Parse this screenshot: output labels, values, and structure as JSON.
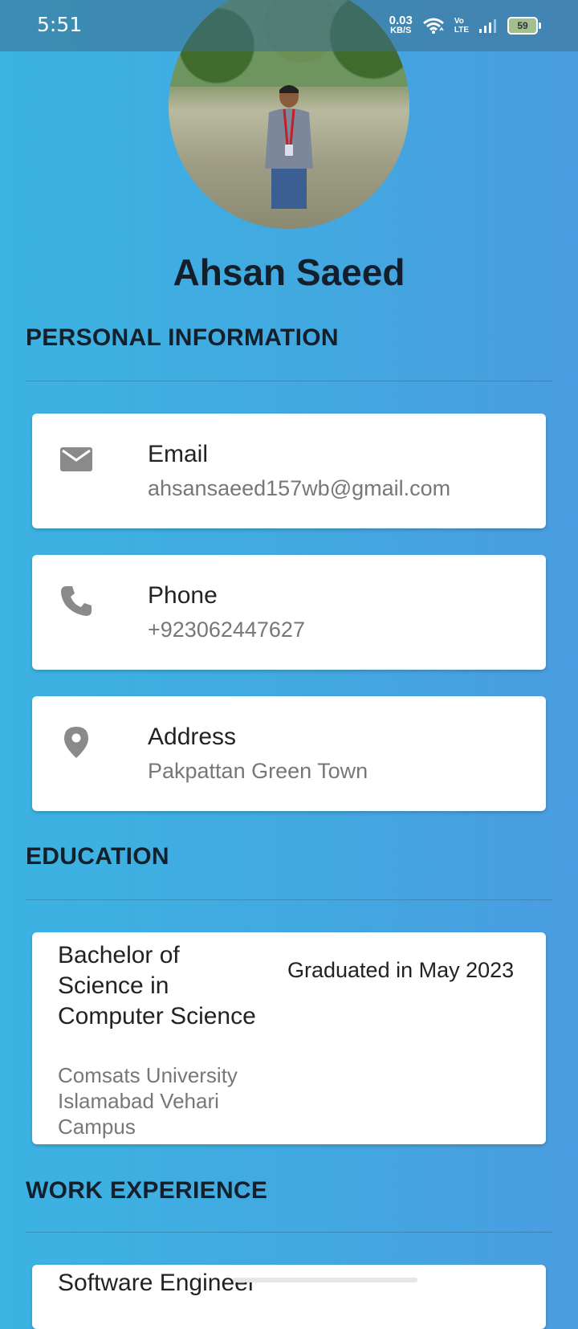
{
  "status_bar": {
    "time": "5:51",
    "net_speed_value": "0.03",
    "net_speed_unit": "KB/S",
    "volte_top": "Vo",
    "volte_bottom": "LTE",
    "battery": "59"
  },
  "profile": {
    "name": "Ahsan Saeed"
  },
  "personal_information": {
    "title": "PERSONAL INFORMATION",
    "items": [
      {
        "icon": "email-icon",
        "label": "Email",
        "value": "ahsansaeed157wb@gmail.com"
      },
      {
        "icon": "phone-icon",
        "label": "Phone",
        "value": "+923062447627"
      },
      {
        "icon": "location-icon",
        "label": "Address",
        "value": "Pakpattan Green Town"
      }
    ]
  },
  "education": {
    "title": "EDUCATION",
    "items": [
      {
        "degree": "Bachelor of Science in Computer Science",
        "school": "Comsats University Islamabad Vehari Campus",
        "date": "Graduated in May 2023"
      }
    ]
  },
  "work_experience": {
    "title": "WORK EXPERIENCE",
    "items": [
      {
        "title": "Software Engineer"
      }
    ]
  },
  "colors": {
    "background_start": "#3cb3e2",
    "background_end": "#4a9de0",
    "icon_gray": "#8a8a8a",
    "heading": "#13202c"
  }
}
